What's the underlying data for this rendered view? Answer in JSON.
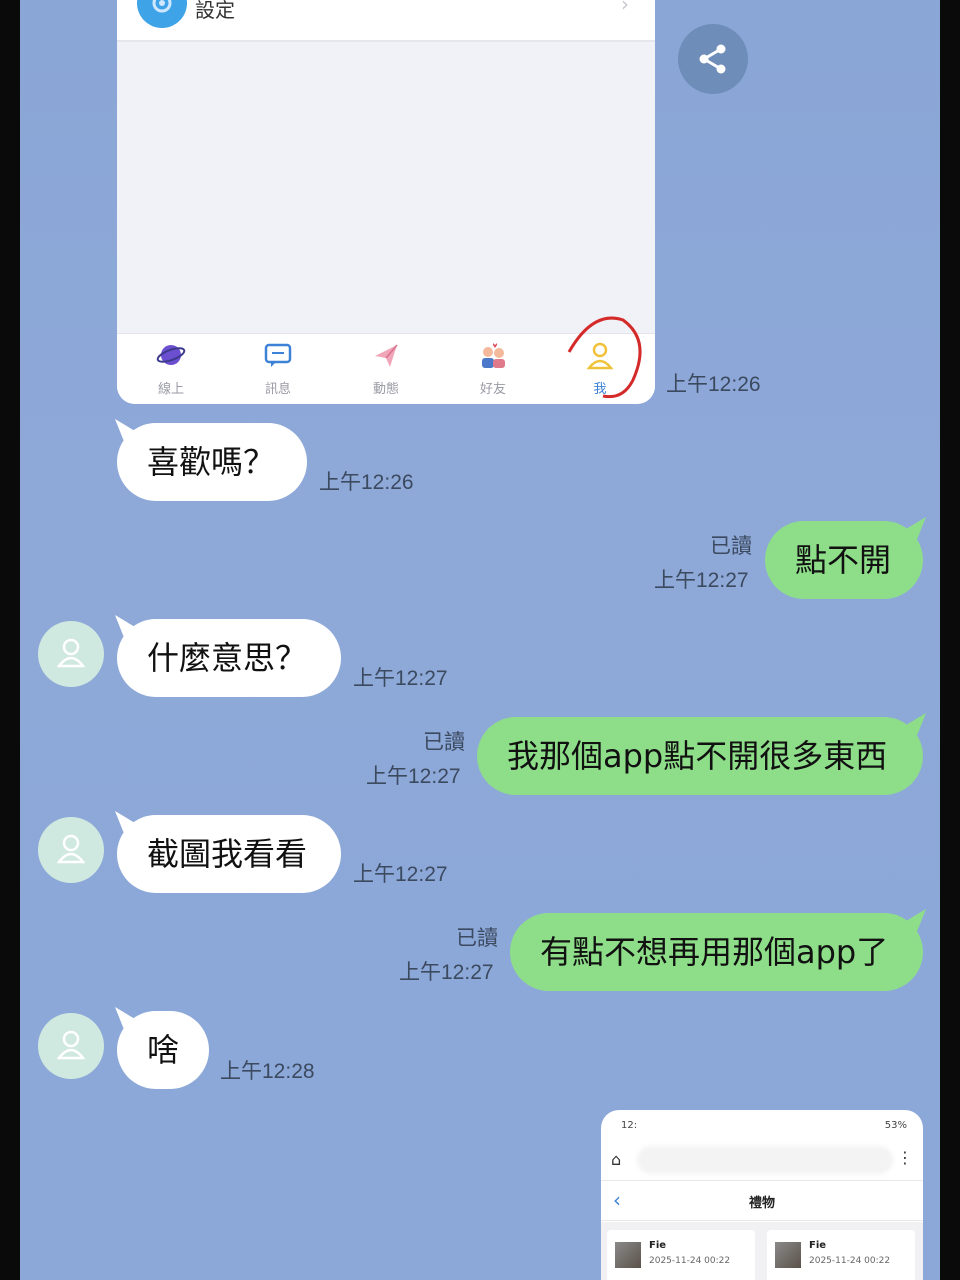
{
  "screenshot_card": {
    "settings_label": "設定",
    "tabs": [
      {
        "label": "線上"
      },
      {
        "label": "訊息"
      },
      {
        "label": "動態"
      },
      {
        "label": "好友"
      },
      {
        "label": "我"
      }
    ],
    "active_tab": "我"
  },
  "messages": [
    {
      "type": "image",
      "time": "上午12:26"
    },
    {
      "type": "in",
      "text": "喜歡嗎？",
      "time": "上午12:26"
    },
    {
      "type": "out",
      "text": "點不開",
      "read": "已讀",
      "time": "上午12:27"
    },
    {
      "type": "in",
      "text": "什麼意思？",
      "time": "上午12:27"
    },
    {
      "type": "out",
      "text": "我那個app點不開很多東西",
      "read": "已讀",
      "time": "上午12:27"
    },
    {
      "type": "in",
      "text": "截圖我看看",
      "time": "上午12:27"
    },
    {
      "type": "out",
      "text": "有點不想再用那個app了",
      "read": "已讀",
      "time": "上午12:27"
    },
    {
      "type": "in",
      "text": "啥",
      "time": "上午12:28"
    }
  ],
  "phone_screenshot": {
    "status_left": "12:",
    "status_right": "53%",
    "header_title": "禮物",
    "gifts": [
      {
        "name": "Fie",
        "date": "2025-11-24 00:22"
      },
      {
        "name": "Fie",
        "date": "2025-11-24 00:22"
      }
    ]
  },
  "colors": {
    "chat_background": "#8aa6d6",
    "incoming_bubble": "#ffffff",
    "outgoing_bubble": "#8ede89",
    "avatar": "#cfe8e0"
  },
  "icons": [
    "share-icon",
    "gear-icon",
    "planet-icon",
    "chat-icon",
    "paper-plane-icon",
    "friends-icon",
    "person-icon",
    "user-avatar-icon"
  ]
}
